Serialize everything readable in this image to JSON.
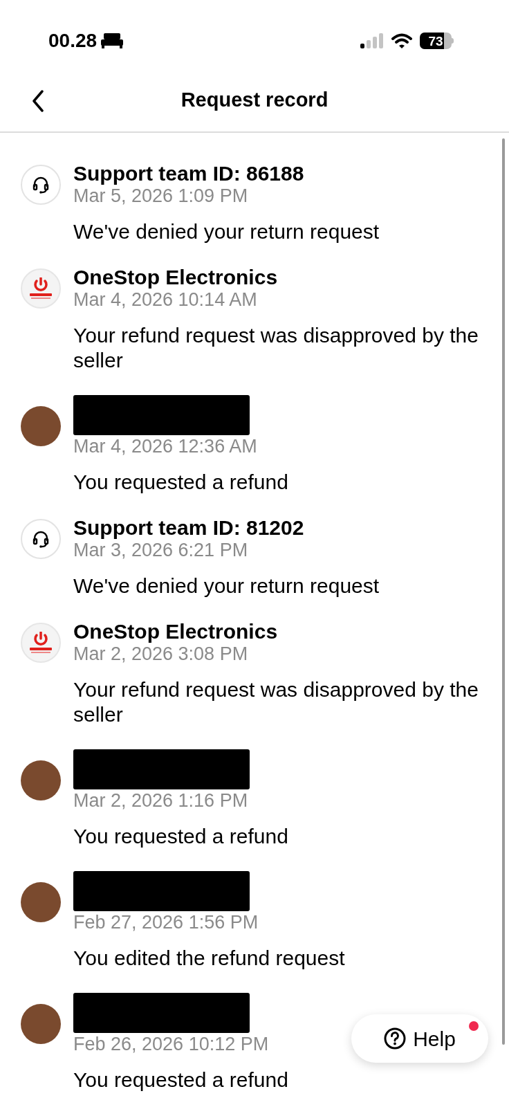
{
  "status_bar": {
    "time": "00.28",
    "battery": "73"
  },
  "header": {
    "title": "Request record"
  },
  "records": [
    {
      "kind": "support",
      "name": "Support team ID: 86188",
      "date": "Mar 5, 2026 1:09 PM",
      "message": "We've denied your return request"
    },
    {
      "kind": "seller",
      "name": "OneStop Electronics",
      "date": "Mar 4, 2026 10:14 AM",
      "message": "Your refund request was disapproved by the seller"
    },
    {
      "kind": "user",
      "date": "Mar 4, 2026 12:36 AM",
      "message": "You requested a refund"
    },
    {
      "kind": "support",
      "name": "Support team ID: 81202",
      "date": "Mar 3, 2026 6:21 PM",
      "message": "We've denied your return request"
    },
    {
      "kind": "seller",
      "name": "OneStop Electronics",
      "date": "Mar 2, 2026 3:08 PM",
      "message": "Your refund request was disapproved by the seller"
    },
    {
      "kind": "user",
      "date": "Mar 2, 2026 1:16 PM",
      "message": "You requested a refund"
    },
    {
      "kind": "user",
      "date": "Feb 27, 2026 1:56 PM",
      "message": "You edited the refund request"
    },
    {
      "kind": "user",
      "date": "Feb 26, 2026 10:12 PM",
      "message": "You requested a refund"
    }
  ],
  "help_button": {
    "label": "Help",
    "badge": true
  }
}
